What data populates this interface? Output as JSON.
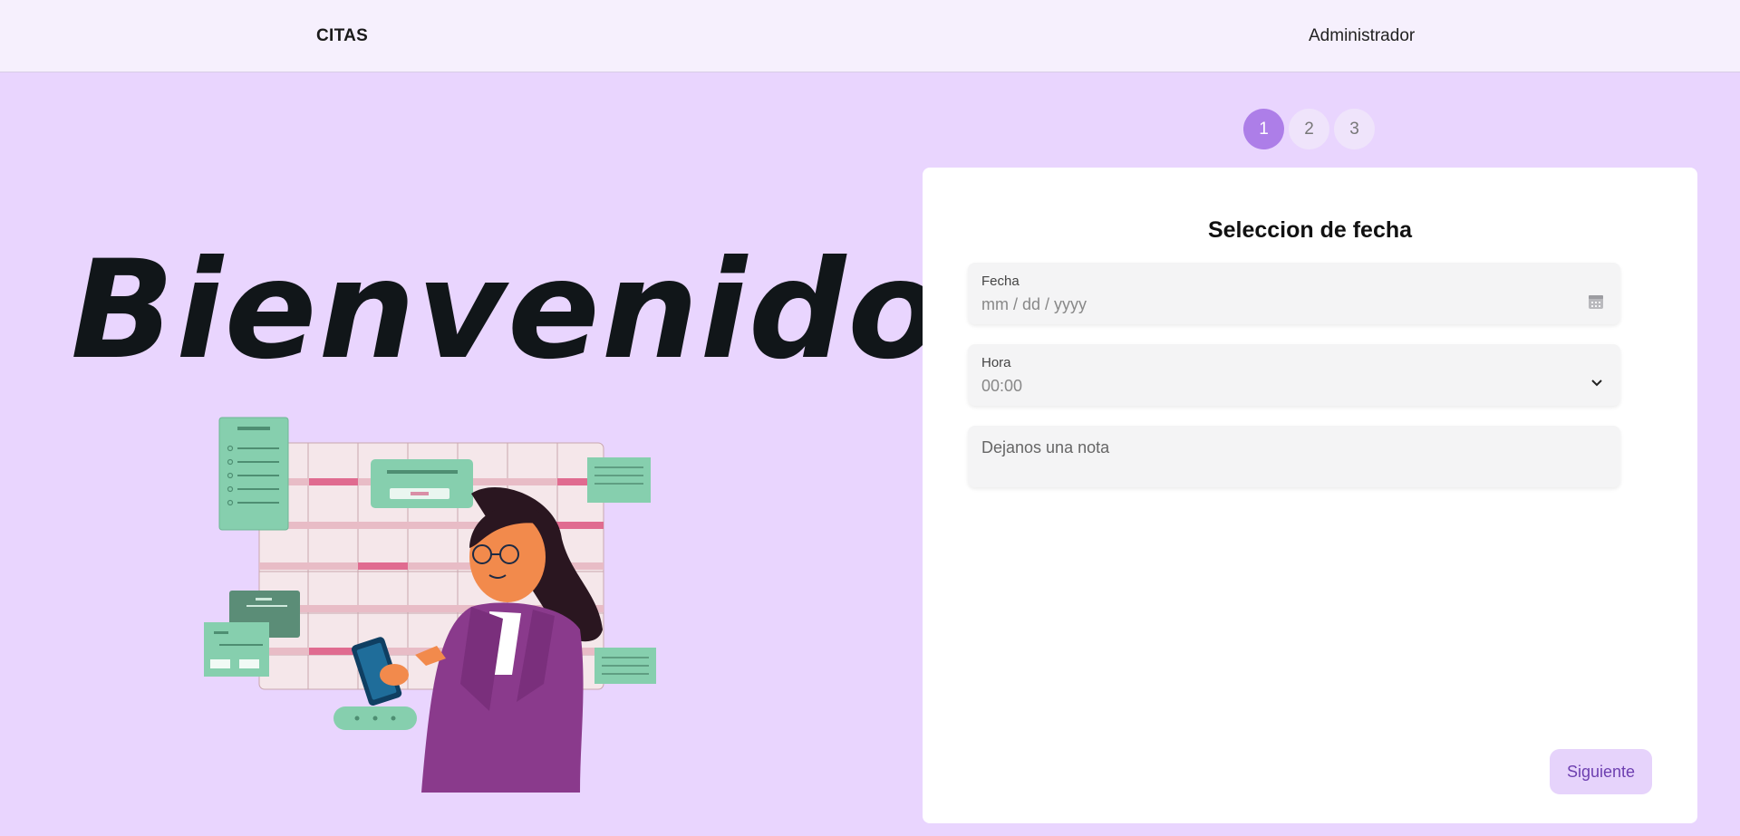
{
  "nav": {
    "brand": "CITAS",
    "admin": "Administrador"
  },
  "hero": {
    "title": "Bienvenido"
  },
  "steps": [
    "1",
    "2",
    "3"
  ],
  "form": {
    "title": "Seleccion de fecha",
    "date_label": "Fecha",
    "date_placeholder": "mm / dd / yyyy",
    "time_label": "Hora",
    "time_value": "00:00",
    "note_placeholder": "Dejanos una nota",
    "next_label": "Siguiente"
  },
  "colors": {
    "accent": "#ad7ee8",
    "background": "#e9d5fe",
    "button": "#e6d3fb"
  },
  "icons": {
    "date": "calendar-icon",
    "time": "chevron-down-icon"
  }
}
